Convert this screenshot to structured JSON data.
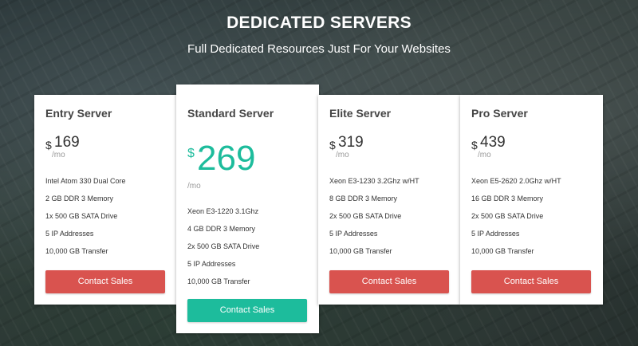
{
  "header": {
    "title": "DEDICATED SERVERS",
    "subtitle": "Full Dedicated Resources Just For Your Websites"
  },
  "colors": {
    "accent_teal": "#1dbc9c",
    "button_red": "#d9534f"
  },
  "plans": [
    {
      "name": "Entry Server",
      "currency": "$",
      "price": "169",
      "period": "/mo",
      "features": [
        "Intel Atom 330 Dual Core",
        "2 GB DDR 3 Memory",
        "1x 500 GB SATA Drive",
        "5 IP Addresses",
        "10,000 GB Transfer"
      ],
      "cta": "Contact Sales"
    },
    {
      "name": "Standard Server",
      "currency": "$",
      "price": "269",
      "period": "/mo",
      "features": [
        "Xeon E3-1220 3.1Ghz",
        "4 GB DDR 3 Memory",
        "2x 500 GB SATA Drive",
        "5 IP Addresses",
        "10,000 GB Transfer"
      ],
      "cta": "Contact Sales"
    },
    {
      "name": "Elite Server",
      "currency": "$",
      "price": "319",
      "period": "/mo",
      "features": [
        "Xeon E3-1230 3.2Ghz w/HT",
        "8 GB DDR 3 Memory",
        "2x 500 GB SATA Drive",
        "5 IP Addresses",
        "10,000 GB Transfer"
      ],
      "cta": "Contact Sales"
    },
    {
      "name": "Pro Server",
      "currency": "$",
      "price": "439",
      "period": "/mo",
      "features": [
        "Xeon E5-2620 2.0Ghz w/HT",
        "16 GB DDR 3 Memory",
        "2x 500 GB SATA Drive",
        "5 IP Addresses",
        "10,000 GB Transfer"
      ],
      "cta": "Contact Sales"
    }
  ]
}
